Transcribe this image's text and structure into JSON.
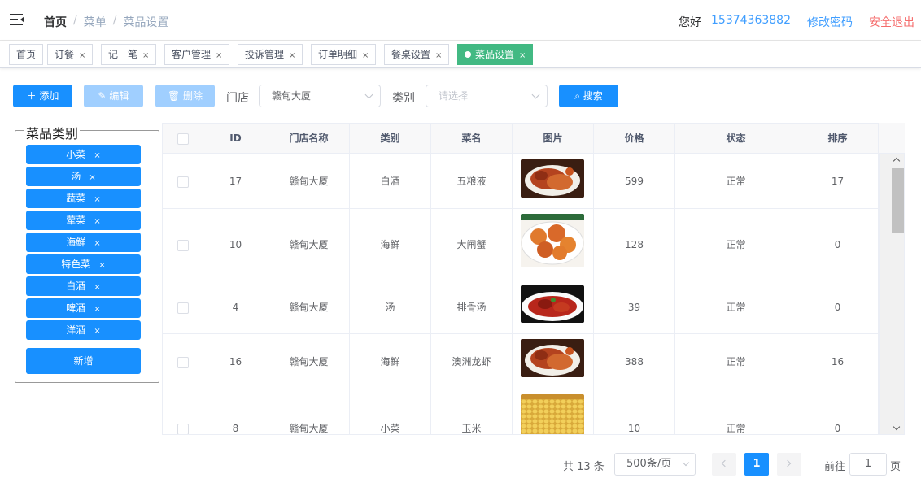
{
  "header": {
    "breadcrumb": [
      "首页",
      "菜单",
      "菜品设置"
    ],
    "greeting": "您好",
    "phone": "15374363882",
    "change_password": "修改密码",
    "logout": "安全退出"
  },
  "tags": [
    {
      "label": "首页",
      "closable": false
    },
    {
      "label": "订餐",
      "closable": true
    },
    {
      "label": "记一笔",
      "closable": true
    },
    {
      "label": "客户管理",
      "closable": true
    },
    {
      "label": "投诉管理",
      "closable": true
    },
    {
      "label": "订单明细",
      "closable": true
    },
    {
      "label": "餐桌设置",
      "closable": true
    },
    {
      "label": "菜品设置",
      "closable": true,
      "active": true
    }
  ],
  "tag_close_glyph": "×",
  "toolbar": {
    "add": "添加",
    "edit": "编辑",
    "delete": "删除",
    "store_label": "门店",
    "store_value": "赣甸大厦",
    "category_label": "类别",
    "category_placeholder": "请选择",
    "search": "搜索"
  },
  "category_panel": {
    "title": "菜品类别",
    "items": [
      "小菜",
      "汤",
      "蔬菜",
      "荤菜",
      "海鲜",
      "特色菜",
      "白酒",
      "啤酒",
      "洋酒"
    ],
    "new_button": "新增"
  },
  "table": {
    "headers": [
      "ID",
      "门店名称",
      "类别",
      "菜名",
      "图片",
      "价格",
      "状态",
      "排序"
    ],
    "rows": [
      {
        "id": "17",
        "store": "赣甸大厦",
        "category": "白酒",
        "name": "五粮液",
        "image": "crab-dish",
        "price": "599",
        "status": "正常",
        "sort": "17"
      },
      {
        "id": "10",
        "store": "赣甸大厦",
        "category": "海鲜",
        "name": "大闸蟹",
        "image": "crab-plate",
        "price": "128",
        "status": "正常",
        "sort": "0"
      },
      {
        "id": "4",
        "store": "赣甸大厦",
        "category": "汤",
        "name": "排骨汤",
        "image": "braised-dish",
        "price": "39",
        "status": "正常",
        "sort": "0"
      },
      {
        "id": "16",
        "store": "赣甸大厦",
        "category": "海鲜",
        "name": "澳洲龙虾",
        "image": "crab-dish",
        "price": "388",
        "status": "正常",
        "sort": "16"
      },
      {
        "id": "8",
        "store": "赣甸大厦",
        "category": "小菜",
        "name": "玉米",
        "image": "corn",
        "price": "10",
        "status": "正常",
        "sort": "0"
      }
    ]
  },
  "pagination": {
    "total": "共 13 条",
    "page_size": "500条/页",
    "current_page": "1",
    "goto_label": "前往",
    "goto_value": "1",
    "page_unit": "页"
  },
  "colors": {
    "primary": "#1890ff",
    "disabled": "#a0cfff",
    "active_tag": "#42b983",
    "link": "#409eff",
    "danger": "#f56c6c"
  }
}
